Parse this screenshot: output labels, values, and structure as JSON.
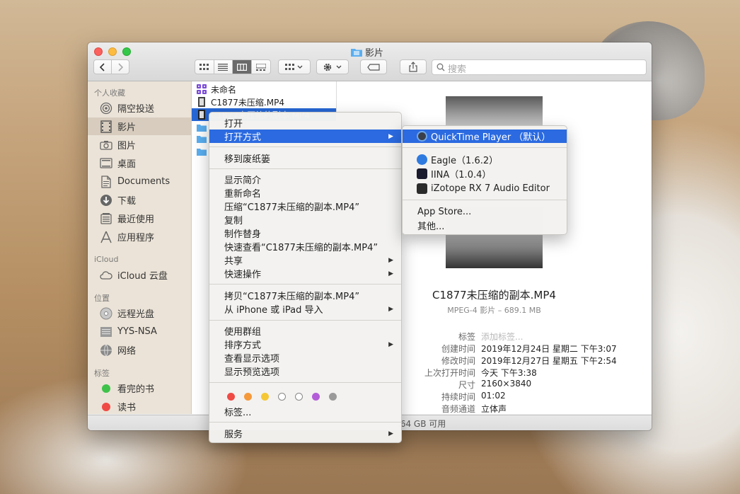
{
  "window": {
    "title": "影片",
    "search_placeholder": "搜索",
    "status_text": ".64 GB 可用"
  },
  "sidebar": {
    "sections": [
      {
        "label": "个人收藏"
      },
      {
        "label": "iCloud"
      },
      {
        "label": "位置"
      },
      {
        "label": "标签"
      }
    ],
    "items": [
      {
        "label": "隔空投送",
        "icon": "airdrop-icon"
      },
      {
        "label": "影片",
        "icon": "movies-icon"
      },
      {
        "label": "图片",
        "icon": "camera-icon"
      },
      {
        "label": "桌面",
        "icon": "desktop-icon"
      },
      {
        "label": "Documents",
        "icon": "document-icon"
      },
      {
        "label": "下载",
        "icon": "download-icon"
      },
      {
        "label": "最近使用",
        "icon": "recents-icon"
      },
      {
        "label": "应用程序",
        "icon": "applications-icon"
      },
      {
        "label": "iCloud 云盘",
        "icon": "cloud-icon"
      },
      {
        "label": "远程光盘",
        "icon": "disc-icon"
      },
      {
        "label": "YYS-NSA",
        "icon": "server-icon"
      },
      {
        "label": "网络",
        "icon": "network-icon"
      },
      {
        "label": "看完的书",
        "icon": "tag-green-icon",
        "color": "#3fc24a"
      },
      {
        "label": "读书",
        "icon": "tag-red-icon",
        "color": "#f04a45"
      }
    ]
  },
  "files": [
    {
      "name": "未命名"
    },
    {
      "name": "C1877未压缩.MP4"
    },
    {
      "name": "C1877未压缩的副本.MP4"
    }
  ],
  "preview": {
    "name": "C1877未压缩的副本.MP4",
    "kind": "MPEG-4 影片 – 689.1 MB",
    "meta": [
      {
        "key": "标签",
        "value": "添加标签..."
      },
      {
        "key": "创建时间",
        "value": "2019年12月24日 星期二 下午3:07"
      },
      {
        "key": "修改时间",
        "value": "2019年12月27日 星期五 下午2:54"
      },
      {
        "key": "上次打开时间",
        "value": "今天 下午3:38"
      },
      {
        "key": "尺寸",
        "value": "2160×3840"
      },
      {
        "key": "持续时间",
        "value": "01:02"
      },
      {
        "key": "音频通道",
        "value": "立体声"
      }
    ]
  },
  "context_menu": {
    "items": [
      {
        "label": "打开"
      },
      {
        "label": "打开方式"
      },
      {
        "label": "移到废纸篓"
      },
      {
        "label": "显示简介"
      },
      {
        "label": "重新命名"
      },
      {
        "label": "压缩“C1877未压缩的副本.MP4”"
      },
      {
        "label": "复制"
      },
      {
        "label": "制作替身"
      },
      {
        "label": "快速查看“C1877未压缩的副本.MP4”"
      },
      {
        "label": "共享"
      },
      {
        "label": "快速操作"
      },
      {
        "label": "拷贝“C1877未压缩的副本.MP4”"
      },
      {
        "label": "从 iPhone 或 iPad 导入"
      },
      {
        "label": "使用群组"
      },
      {
        "label": "排序方式"
      },
      {
        "label": "查看显示选项"
      },
      {
        "label": "显示预览选项"
      },
      {
        "label": "标签..."
      },
      {
        "label": "服务"
      }
    ],
    "tag_colors": [
      "#f04a45",
      "#f5993a",
      "#f5c734",
      "#ffffff",
      "#ffffff",
      "#b35ed8",
      "#9a9a9a"
    ]
  },
  "submenu": {
    "items": [
      {
        "label": "QuickTime Player （默认）",
        "icon": "quicktime-icon"
      },
      {
        "label": "Eagle（1.6.2）",
        "icon": "eagle-icon"
      },
      {
        "label": "IINA（1.0.4）",
        "icon": "iina-icon"
      },
      {
        "label": "iZotope RX 7 Audio Editor",
        "icon": "izotope-icon"
      },
      {
        "label": "App Store..."
      },
      {
        "label": "其他..."
      }
    ]
  }
}
